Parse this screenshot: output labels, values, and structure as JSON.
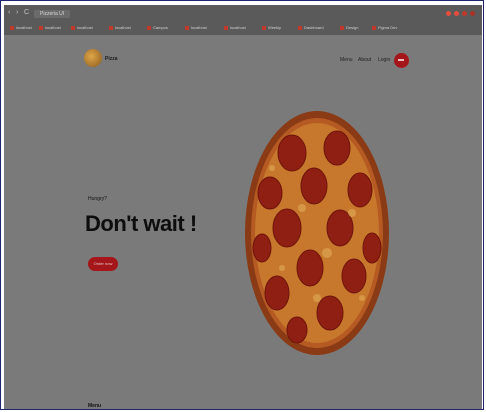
{
  "browser": {
    "back_label": "‹",
    "forward_label": "›",
    "reload_label": "C",
    "tab_title": "Pizzeria UI",
    "window_dot_colors": [
      "#e74c3c",
      "#e74c3c",
      "#c0392b",
      "#a93226"
    ],
    "bookmarks": [
      "localhost",
      "localhost",
      "localhost",
      "localhost",
      "Campus",
      "localhost",
      "localhost",
      "Weekly",
      "Dashboard",
      "Design",
      "Figma Dev"
    ]
  },
  "header": {
    "logo_text": "Pizza",
    "nav": [
      "Menu",
      "About",
      "Login"
    ],
    "cart_icon": "cart-icon"
  },
  "hero": {
    "kicker": "Hungry?",
    "title": "Don't wait !",
    "button_label": "Order now",
    "image_icon": "pepperoni-pizza-image"
  },
  "footer": {
    "heading": "Menu"
  },
  "colors": {
    "accent": "#a4161a",
    "page_bg": "#7a7a7a",
    "browser_bg": "#5a5a5a",
    "frame_border": "#20246e"
  }
}
